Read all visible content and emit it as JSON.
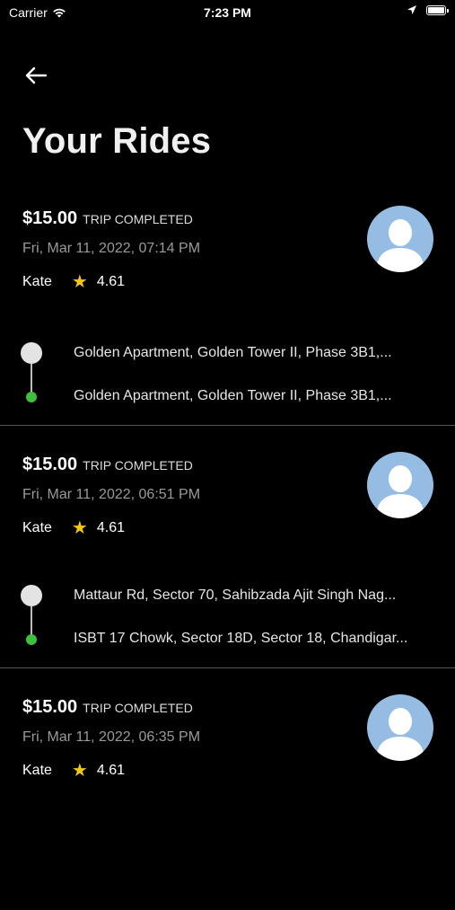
{
  "status_bar": {
    "carrier": "Carrier",
    "time": "7:23 PM"
  },
  "header": {
    "title": "Your Rides"
  },
  "rides": [
    {
      "fare": "$15.00",
      "status": "TRIP COMPLETED",
      "datetime": "Fri, Mar 11, 2022, 07:14 PM",
      "driver": "Kate",
      "rating": "4.61",
      "pickup": "Golden Apartment, Golden Tower II, Phase 3B1,...",
      "dropoff": "Golden Apartment, Golden Tower II, Phase 3B1,..."
    },
    {
      "fare": "$15.00",
      "status": "TRIP COMPLETED",
      "datetime": "Fri, Mar 11, 2022, 06:51 PM",
      "driver": "Kate",
      "rating": "4.61",
      "pickup": "Mattaur Rd, Sector 70, Sahibzada Ajit Singh Nag...",
      "dropoff": "ISBT 17 Chowk, Sector 18D, Sector 18, Chandigar..."
    },
    {
      "fare": "$15.00",
      "status": "TRIP COMPLETED",
      "datetime": "Fri, Mar 11, 2022, 06:35 PM",
      "driver": "Kate",
      "rating": "4.61"
    }
  ],
  "colors": {
    "background": "#000000",
    "avatar": "#95bde4",
    "star": "#f5c518",
    "dropoff_dot": "#3fbf3f"
  }
}
